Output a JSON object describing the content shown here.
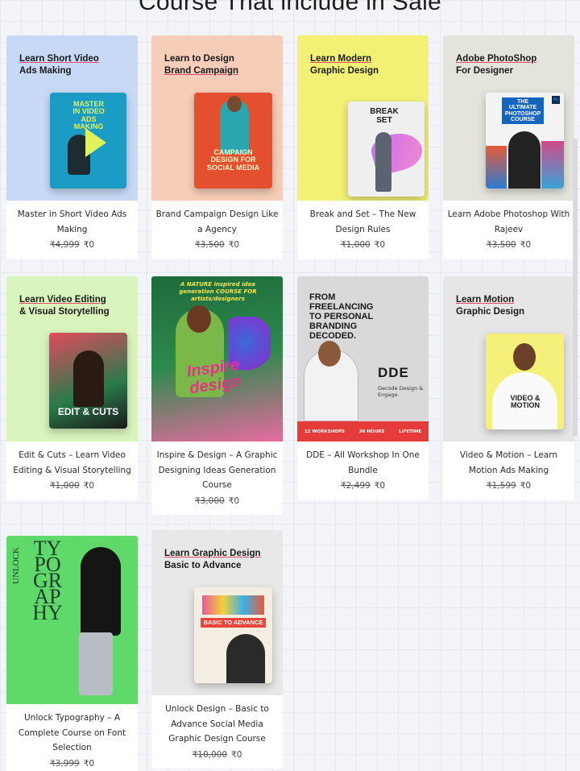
{
  "page": {
    "heading": "Course That include in Sale"
  },
  "colors": {
    "accent_pink": "#e84a6a",
    "card_bg": "#ffffff"
  },
  "courses": [
    {
      "title": "Master in Short Video Ads Making",
      "old_price": "₹4,999",
      "new_price": "₹0",
      "thumb": {
        "heading_line1": "Learn Short Video",
        "heading_line2": "Ads Making",
        "poster_text": "MASTER IN VIDEO ADS MAKING"
      }
    },
    {
      "title": "Brand Campaign Design Like a Agency",
      "old_price": "₹3,500",
      "new_price": "₹0",
      "thumb": {
        "heading_line1": "Learn to Design",
        "heading_line2": "Brand Campaign",
        "poster_text": "CAMPAIGN DESIGN FOR SOCIAL MEDIA"
      }
    },
    {
      "title": "Break and Set – The New Design Rules",
      "old_price": "₹1,000",
      "new_price": "₹0",
      "thumb": {
        "heading_line1": "Learn Modern",
        "heading_line2": "Graphic Design",
        "poster_text": "BREAK SET"
      }
    },
    {
      "title": "Learn Adobe Photoshop With Rajeev",
      "old_price": "₹3,500",
      "new_price": "₹0",
      "thumb": {
        "heading_line1": "Adobe PhotoShop",
        "heading_line2": "For Designer",
        "poster_text": "THE ULTIMATE PHOTOSHOP COURSE"
      }
    },
    {
      "title": "Edit & Cuts – Learn Video Editing & Visual Storytelling",
      "old_price": "₹1,000",
      "new_price": "₹0",
      "thumb": {
        "heading_line1": "Learn Video Editing",
        "heading_line2": "& Visual Storytelling",
        "poster_text": "EDIT & CUTS"
      }
    },
    {
      "title": "Inspire & Design – A Graphic Designing Ideas Generation Course",
      "old_price": "₹3,000",
      "new_price": "₹0",
      "thumb": {
        "top_text": "A NATURE inspired idea generation COURSE FOR artists/designers",
        "poster_text": "Inspire design"
      }
    },
    {
      "title": "DDE – All Workshop In One Bundle",
      "old_price": "₹2,499",
      "new_price": "₹0",
      "thumb": {
        "headline": "FROM FREELANCING TO PERSONAL BRANDING DECODED.",
        "brand": "DDE",
        "brand_sub": "Decode Design & Engage.",
        "stats": [
          "12 WORKSHOPS",
          "36 HOURS",
          "LIFETIME"
        ]
      }
    },
    {
      "title": "Video & Motion – Learn Motion Ads Making",
      "old_price": "₹1,599",
      "new_price": "₹0",
      "thumb": {
        "heading_line1": "Learn Motion",
        "heading_line2": "Graphic Design",
        "poster_text": "VIDEO & MOTION"
      }
    },
    {
      "title": "Unlock Typography – A Complete Course on Font Selection",
      "old_price": "₹3,999",
      "new_price": "₹0",
      "thumb": {
        "poster_text": "TYPOGRAPHY",
        "side_text": "UNLOCK"
      }
    },
    {
      "title": "Unlock Design – Basic to Advance Social Media Graphic Design Course",
      "old_price": "₹10,000",
      "new_price": "₹0",
      "thumb": {
        "heading_line1": "Learn Graphic Design",
        "heading_line2": "Basic to Advance",
        "poster_text": "BASIC TO ADVANCE"
      }
    }
  ]
}
